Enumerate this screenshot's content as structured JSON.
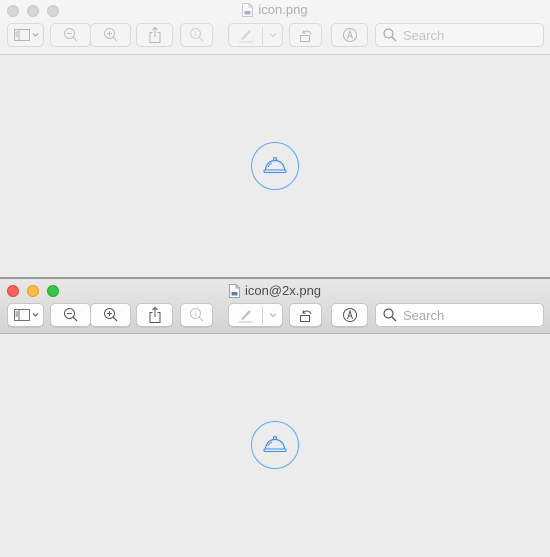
{
  "windows": [
    {
      "id": "win1",
      "state": "inactive",
      "title": "icon.png",
      "toolbar": {
        "sidebar_button": "sidebar-toggle",
        "zoom_out": "zoom-out",
        "zoom_in": "zoom-in",
        "share": "share",
        "zoom_actual_size": "actual-size",
        "markup_pen": "markup",
        "markup_menu": "markup-menu",
        "rotate": "rotate-left",
        "annotate": "annotate",
        "search_placeholder": "Search",
        "search_value": ""
      },
      "image": {
        "description": "food cloche icon in blue circle",
        "accent_color": "#4a9ff5"
      }
    },
    {
      "id": "win2",
      "state": "active",
      "title": "icon@2x.png",
      "toolbar": {
        "sidebar_button": "sidebar-toggle",
        "zoom_out": "zoom-out",
        "zoom_in": "zoom-in",
        "share": "share",
        "zoom_actual_size": "actual-size",
        "markup_pen": "markup",
        "markup_menu": "markup-menu",
        "rotate": "rotate-left",
        "annotate": "annotate",
        "search_placeholder": "Search",
        "search_value": ""
      },
      "image": {
        "description": "food cloche icon in blue circle",
        "accent_color": "#4a9ff5"
      }
    }
  ],
  "colors": {
    "close": "#fc605c",
    "minimize": "#fdbc40",
    "maximize": "#34c84a",
    "icon_accent": "#4a9ff5"
  }
}
